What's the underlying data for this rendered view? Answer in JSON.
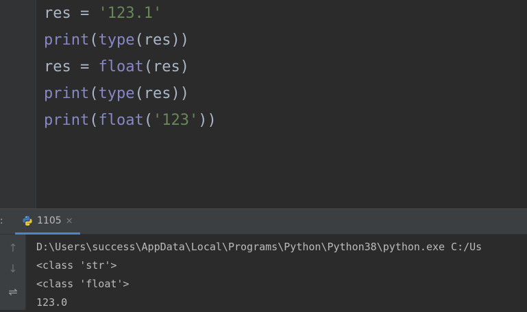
{
  "editor": {
    "lines": [
      [
        {
          "t": "res",
          "k": "var"
        },
        {
          "t": " = ",
          "k": "op"
        },
        {
          "t": "'123.1'",
          "k": "str"
        }
      ],
      [
        {
          "t": "print",
          "k": "func"
        },
        {
          "t": "(",
          "k": "op"
        },
        {
          "t": "type",
          "k": "func"
        },
        {
          "t": "(res))",
          "k": "op"
        }
      ],
      [
        {
          "t": "res",
          "k": "var"
        },
        {
          "t": " = ",
          "k": "op"
        },
        {
          "t": "float",
          "k": "func"
        },
        {
          "t": "(res)",
          "k": "op"
        }
      ],
      [
        {
          "t": "print",
          "k": "func"
        },
        {
          "t": "(",
          "k": "op"
        },
        {
          "t": "type",
          "k": "func"
        },
        {
          "t": "(res))",
          "k": "op"
        }
      ],
      [
        {
          "t": "print",
          "k": "func"
        },
        {
          "t": "(",
          "k": "op"
        },
        {
          "t": "float",
          "k": "func"
        },
        {
          "t": "(",
          "k": "op"
        },
        {
          "t": "'123'",
          "k": "str"
        },
        {
          "t": "))",
          "k": "op"
        }
      ]
    ]
  },
  "run_panel": {
    "label": ":",
    "tab_title": "1105",
    "close_glyph": "×",
    "toolbar_glyphs": {
      "up": "↑",
      "down": "↓",
      "wrap": "⇌"
    }
  },
  "console": {
    "lines": [
      "D:\\Users\\success\\AppData\\Local\\Programs\\Python\\Python38\\python.exe C:/Us",
      "<class 'str'>",
      "<class 'float'>",
      "123.0"
    ]
  },
  "colors": {
    "background": "#2b2b2b",
    "function": "#8888c6",
    "string": "#6a8759",
    "plain": "#a9b7c6",
    "console_text": "#bbbbbb",
    "tab_underline": "#4a88c7"
  }
}
